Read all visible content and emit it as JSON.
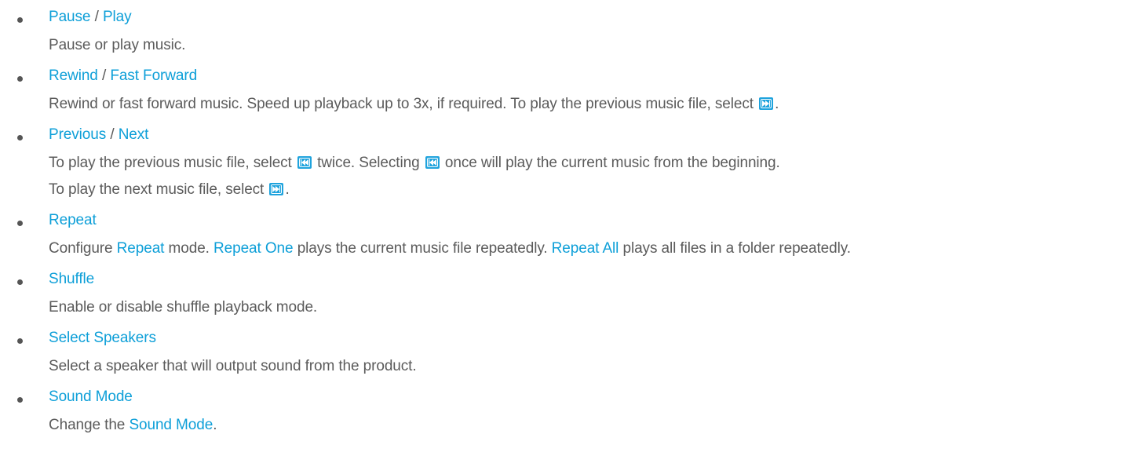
{
  "items": [
    {
      "heading_a": "Pause",
      "separator": "/",
      "heading_b": "Play",
      "description": "Pause or play music."
    },
    {
      "heading_a": "Rewind",
      "separator": "/",
      "heading_b": "Fast Forward",
      "description_pre": "Rewind or fast forward music. Speed up playback up to 3x, if required. To play the previous music file, select",
      "description_post": "."
    },
    {
      "heading_a": "Previous",
      "separator": "/",
      "heading_b": "Next",
      "line1_pre": "To play the previous music file, select",
      "line1_mid": "twice. Selecting",
      "line1_post": "once will play the current music from the beginning.",
      "line2_pre": "To play the next music file, select",
      "line2_post": "."
    },
    {
      "heading_a": "Repeat",
      "description_1": "Configure",
      "description_link_1": "Repeat",
      "description_2": "mode.",
      "description_link_2": "Repeat One",
      "description_3": "plays the current music file repeatedly.",
      "description_link_3": "Repeat All",
      "description_4": "plays all files in a folder repeatedly."
    },
    {
      "heading_a": "Shuffle",
      "description": "Enable or disable shuffle playback mode."
    },
    {
      "heading_a": "Select Speakers",
      "description": "Select a speaker that will output sound from the product."
    },
    {
      "heading_a": "Sound Mode",
      "description_pre": "Change the",
      "description_link": "Sound Mode",
      "description_post": "."
    }
  ],
  "icons": {
    "previous": "skip-previous-icon",
    "next": "skip-next-icon"
  },
  "colors": {
    "accent": "#0d9fd8",
    "text": "#5a5a5a",
    "icon_fill": "#1fa3dd"
  }
}
